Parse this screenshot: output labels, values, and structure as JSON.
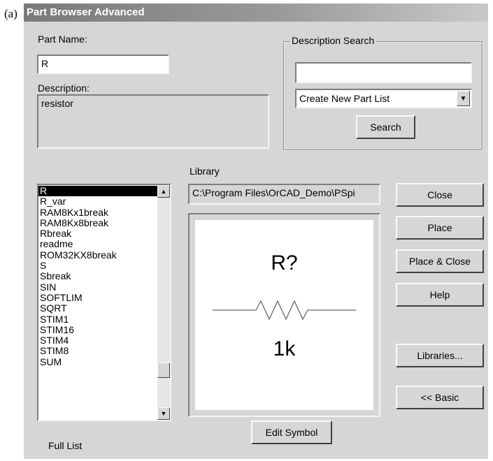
{
  "figure_label": "(a)",
  "window": {
    "title": "Part Browser Advanced"
  },
  "part_name": {
    "label": "Part Name:",
    "value": "R"
  },
  "description": {
    "label": "Description:",
    "value": "resistor"
  },
  "description_search": {
    "group_title": "Description Search",
    "input_value": "",
    "dropdown_selected": "Create New Part List",
    "search_button": "Search"
  },
  "library": {
    "label": "Library",
    "path": "C:\\Program Files\\OrCAD_Demo\\PSpi"
  },
  "part_list": {
    "items": [
      "R",
      "R_var",
      "RAM8Kx1break",
      "RAM8Kx8break",
      "Rbreak",
      "readme",
      "ROM32KX8break",
      "S",
      "Sbreak",
      "SIN",
      "SOFTLIM",
      "SQRT",
      "STIM1",
      "STIM16",
      "STIM4",
      "STIM8",
      "SUM"
    ],
    "selected": "R",
    "footer": "Full List"
  },
  "preview": {
    "ref_designator": "R?",
    "value_text": "1k",
    "symbol": "resistor-symbol"
  },
  "buttons": {
    "close": "Close",
    "place": "Place",
    "place_close": "Place & Close",
    "help": "Help",
    "libraries": "Libraries...",
    "basic": "<< Basic",
    "edit_symbol": "Edit Symbol"
  },
  "icons": {
    "dropdown": "dropdown-arrow-icon",
    "scroll_up": "scroll-up-icon",
    "scroll_down": "scroll-down-icon"
  },
  "colors": {
    "title_start": "#7a7a7a",
    "title_end": "#c9c9c9",
    "dialog_bg": "#d6d6d6",
    "selection": "#000000"
  }
}
